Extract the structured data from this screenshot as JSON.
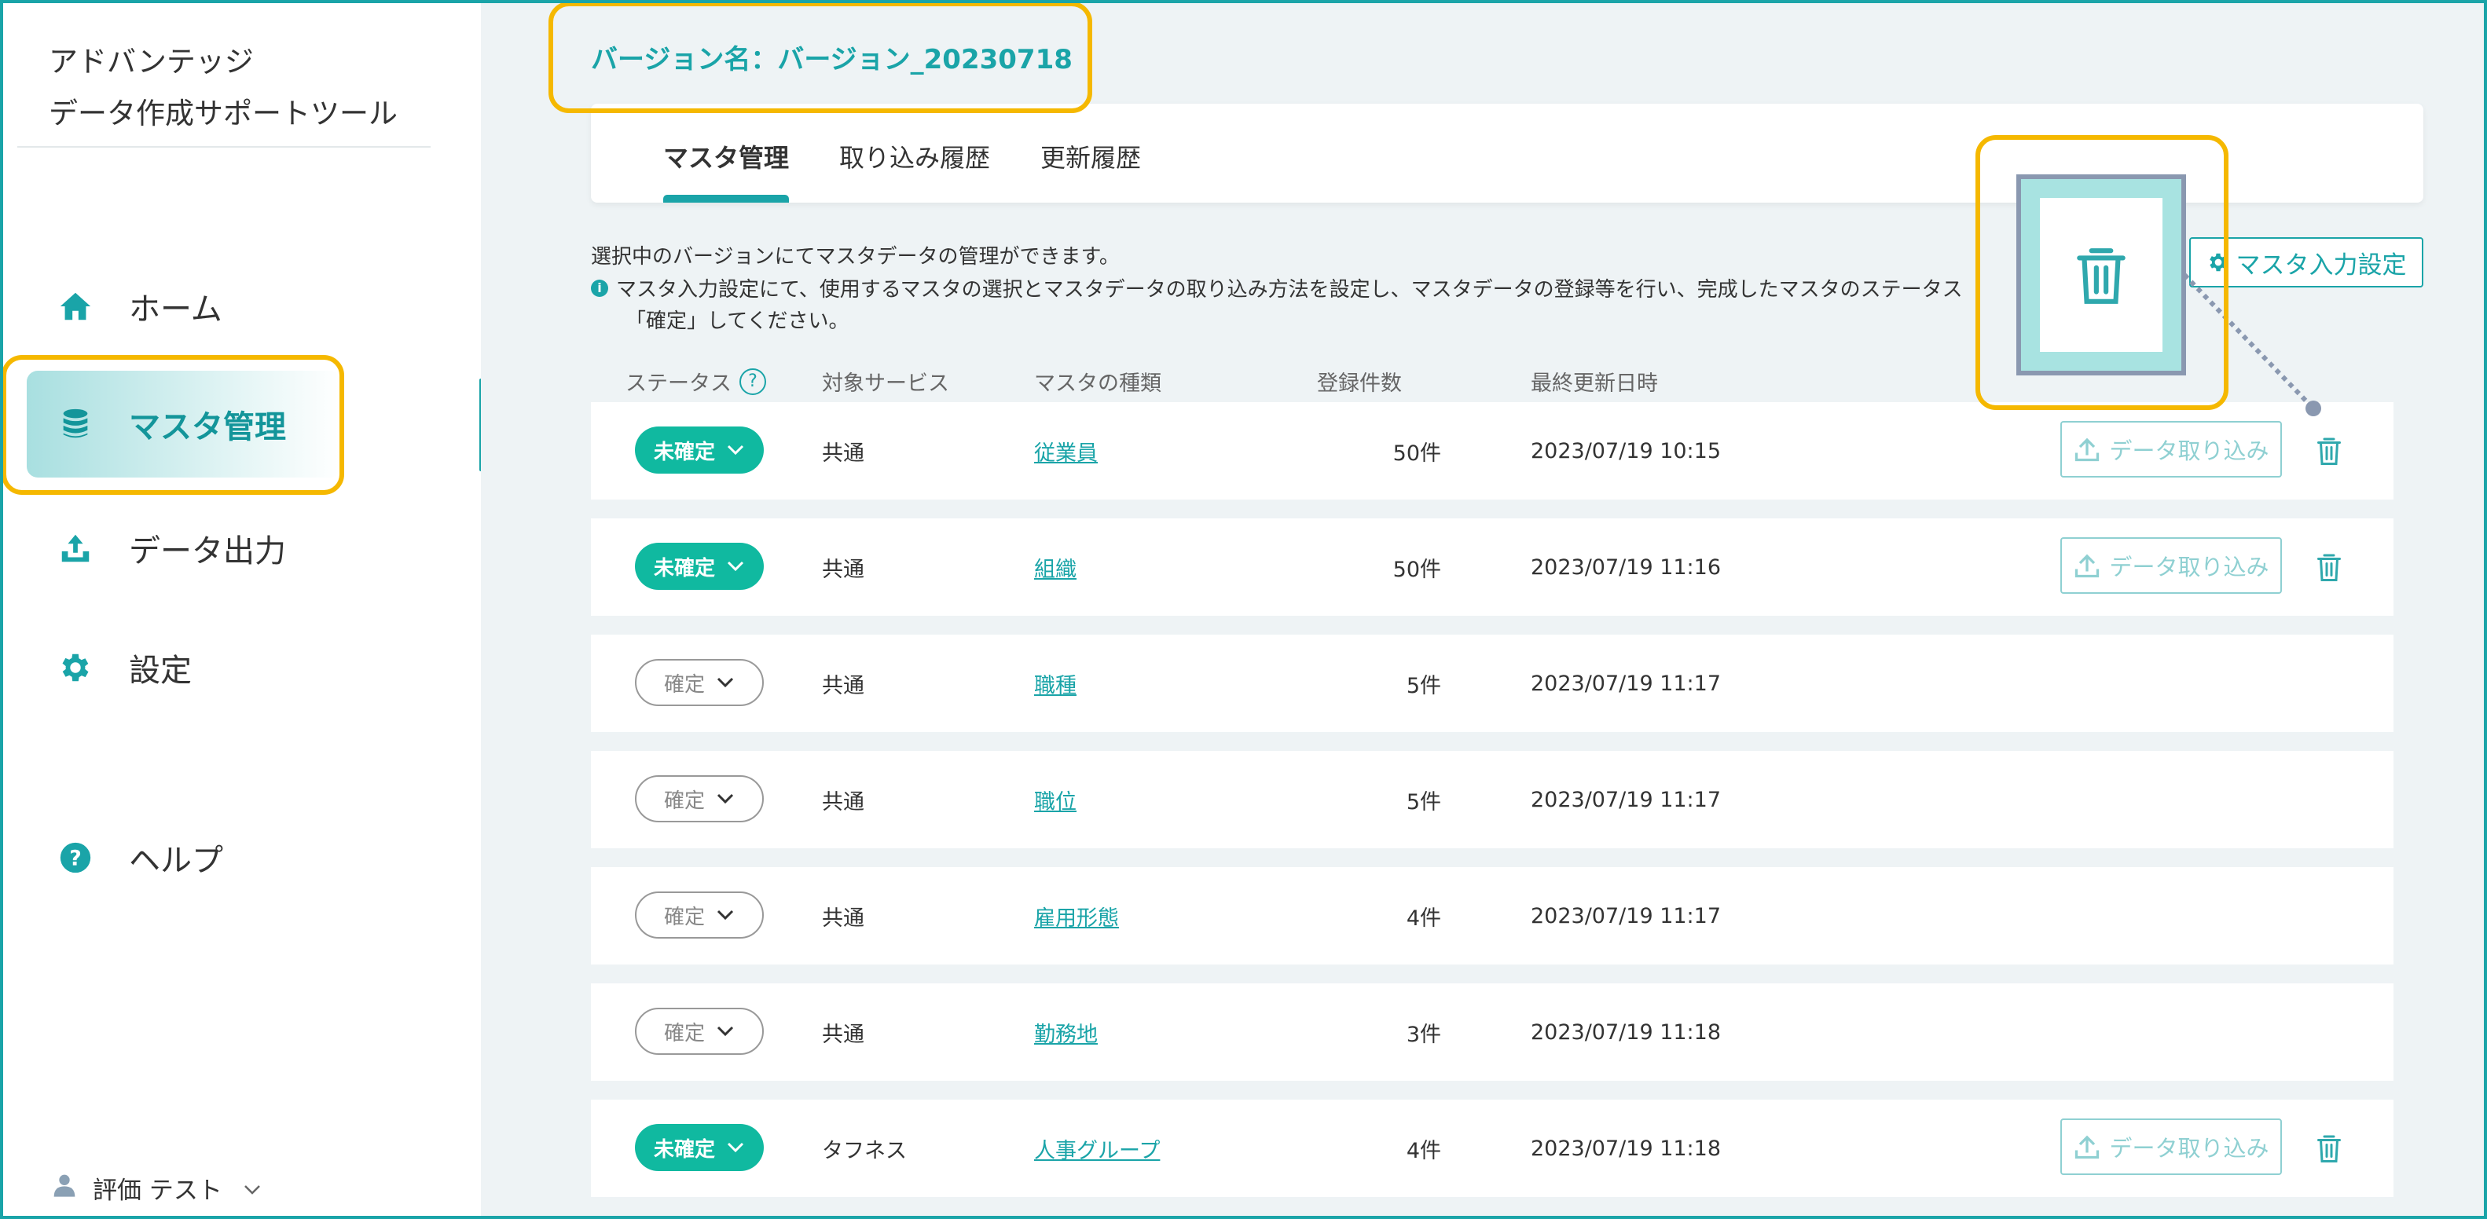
{
  "app": {
    "title_line1": "アドバンテッジ",
    "title_line2": "データ作成サポートツール"
  },
  "sidebar": {
    "items": [
      {
        "label": "ホーム",
        "icon": "home-icon"
      },
      {
        "label": "マスタ管理",
        "icon": "database-icon",
        "active": true
      },
      {
        "label": "データ出力",
        "icon": "upload-icon"
      },
      {
        "label": "設定",
        "icon": "gear-icon"
      },
      {
        "label": "ヘルプ",
        "icon": "help-icon"
      }
    ],
    "user": "評価 テスト"
  },
  "header": {
    "version": "バージョン名：バージョン_20230718"
  },
  "tabs": [
    {
      "label": "マスタ管理",
      "active": true
    },
    {
      "label": "取り込み履歴"
    },
    {
      "label": "更新履歴"
    }
  ],
  "description": {
    "line1": "選択中のバージョンにてマスタデータの管理ができます。",
    "line2": "マスタ入力設定にて、使用するマスタの選択とマスタデータの取り込み方法を設定し、マスタデータの登録等を行い、完成したマスタのステータス",
    "line3": "「確定」してください。"
  },
  "settings_button": "マスタ入力設定",
  "table": {
    "headers": [
      "ステータス",
      "対象サービス",
      "マスタの種類",
      "登録件数",
      "最終更新日時"
    ],
    "import_label": "データ取り込み",
    "rows": [
      {
        "status": "未確定",
        "unconfirmed": true,
        "service": "共通",
        "master": "従業員",
        "count": "50件",
        "updated": "2023/07/19 10:15",
        "import": true
      },
      {
        "status": "未確定",
        "unconfirmed": true,
        "service": "共通",
        "master": "組織",
        "count": "50件",
        "updated": "2023/07/19 11:16",
        "import": true
      },
      {
        "status": "確定",
        "unconfirmed": false,
        "service": "共通",
        "master": "職種",
        "count": "5件",
        "updated": "2023/07/19 11:17",
        "import": false
      },
      {
        "status": "確定",
        "unconfirmed": false,
        "service": "共通",
        "master": "職位",
        "count": "5件",
        "updated": "2023/07/19 11:17",
        "import": false
      },
      {
        "status": "確定",
        "unconfirmed": false,
        "service": "共通",
        "master": "雇用形態",
        "count": "4件",
        "updated": "2023/07/19 11:17",
        "import": false
      },
      {
        "status": "確定",
        "unconfirmed": false,
        "service": "共通",
        "master": "勤務地",
        "count": "3件",
        "updated": "2023/07/19 11:18",
        "import": false
      },
      {
        "status": "未確定",
        "unconfirmed": true,
        "service": "タフネス",
        "master": "人事グループ",
        "count": "4件",
        "updated": "2023/07/19 11:18",
        "import": true
      }
    ]
  },
  "colors": {
    "accent": "#1aa4a8",
    "status_unconfirmed": "#10b9a0",
    "highlight": "#f5b800"
  }
}
